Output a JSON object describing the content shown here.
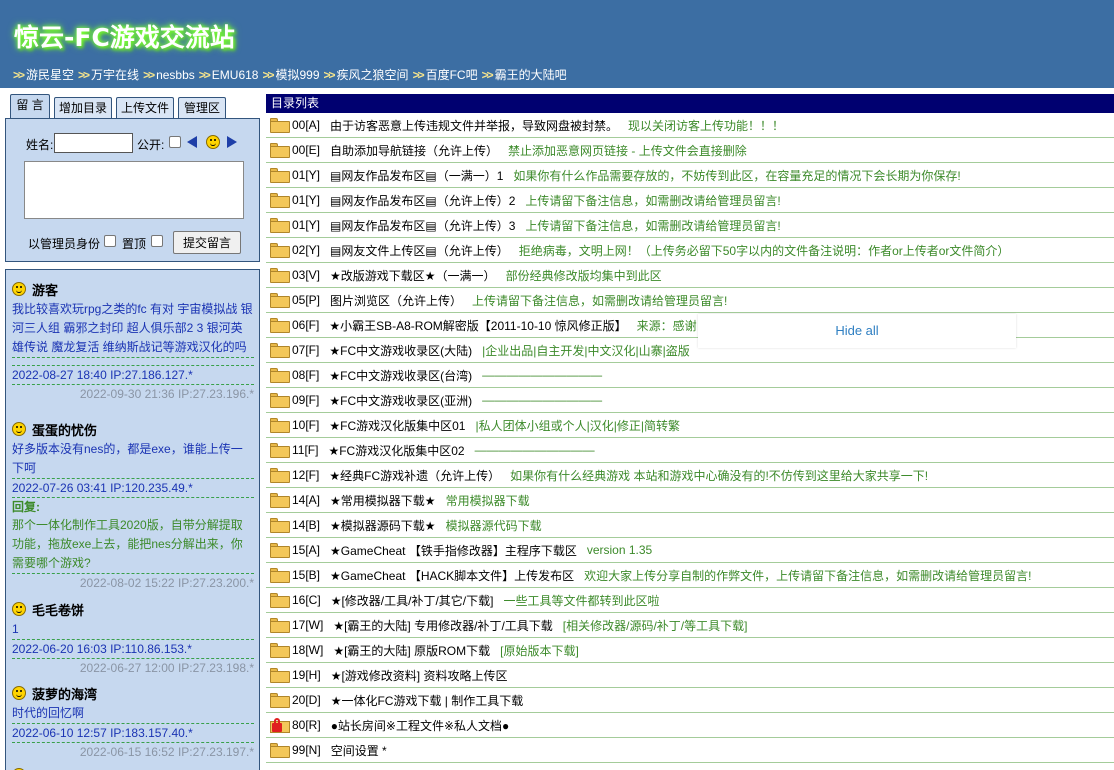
{
  "header": {
    "title": "惊云-FC游戏交流站",
    "nav_arrows": ">>",
    "nav_links": [
      "游民星空",
      "万宇在线",
      "nesbbs",
      "EMU618",
      "模拟999",
      "疾风之狼空间",
      "百度FC吧",
      "霸王的大陆吧"
    ]
  },
  "tabs": [
    "留 言",
    "增加目录",
    "上传文件",
    "管理区"
  ],
  "form": {
    "name_label": "姓名:",
    "public_label": "公开:",
    "admin_label": "以管理员身份",
    "pin_label": "置顶",
    "submit_label": "提交留言",
    "prev_icon": "left-triangle-icon",
    "next_icon": "right-triangle-icon"
  },
  "messages": [
    {
      "author": "游客",
      "body": "我比较喜欢玩rpg之类的fc 有对 宇宙模拟战 银河三人组 霸邪之封印 超人俱乐部2 3 银河英雄传说 魔龙复活 维纳斯战记等游戏汉化的吗",
      "meta": "2022-08-27 18:40 IP:27.186.127.*",
      "reply_label": "",
      "reply": "",
      "reply_time": "2022-09-30 21:36 IP:27.23.196.*"
    },
    {
      "author": "蛋蛋的忧伤",
      "body": "好多版本没有nes的，都是exe，谁能上传一下呵",
      "meta": "2022-07-26 03:41 IP:120.235.49.*",
      "reply_label": "回复:",
      "reply": "那个一体化制作工具2020版，自带分解提取功能，拖放exe上去，能把nes分解出来，你需要哪个游戏?",
      "reply_time": "2022-08-02 15:22 IP:27.23.200.*"
    },
    {
      "author": "毛毛卷饼",
      "body": "1",
      "meta": "2022-06-20 16:03 IP:110.86.153.*",
      "reply_label": "",
      "reply": "",
      "reply_time": "2022-06-27 12:00 IP:27.23.198.*"
    },
    {
      "author": "菠萝的海湾",
      "body": "时代的回忆啊",
      "meta": "2022-06-10 12:57 IP:183.157.40.*",
      "reply_label": "",
      "reply": "",
      "reply_time": "2022-06-15 16:52 IP:27.23.197.*"
    }
  ],
  "directory": {
    "header": "目录列表",
    "rows": [
      {
        "code": "00[A]",
        "name": "由于访客恶意上传违规文件并举报，导致网盘被封禁。",
        "desc": "现以关闭访客上传功能！！！",
        "icon": "folder-icon"
      },
      {
        "code": "00[E]",
        "name": "自助添加导航链接（允许上传）",
        "desc": "禁止添加恶意网页链接 - 上传文件会直接删除",
        "icon": "folder-icon"
      },
      {
        "code": "01[Y]",
        "name": "▤网友作品发布区▤（一满一）1",
        "desc": "如果你有什么作品需要存放的，不妨传到此区，在容量充足的情况下会长期为你保存!",
        "icon": "folder-icon"
      },
      {
        "code": "01[Y]",
        "name": "▤网友作品发布区▤（允许上传）2",
        "desc": "上传请留下备注信息，如需删改请给管理员留言!",
        "icon": "folder-icon"
      },
      {
        "code": "01[Y]",
        "name": "▤网友作品发布区▤（允许上传）3",
        "desc": "上传请留下备注信息，如需删改请给管理员留言!",
        "icon": "folder-icon"
      },
      {
        "code": "02[Y]",
        "name": "▤网友文件上传区▤（允许上传）",
        "desc": "拒绝病毒，文明上网！（上传务必留下50字以内的文件备注说明：作者or上传者or文件简介）",
        "icon": "folder-icon"
      },
      {
        "code": "03[V]",
        "name": "★改版游戏下载区★（一满一）",
        "desc": "部份经典修改版均集中到此区",
        "icon": "folder-icon"
      },
      {
        "code": "05[P]",
        "name": "图片浏览区（允许上传）",
        "desc": "上传请留下备注信息，如需删改请给管理员留言!",
        "icon": "folder-icon"
      },
      {
        "code": "06[F]",
        "name": "★小霸王SB-A8-ROM解密版【2011-10-10 惊风修正版】",
        "desc": "来源：感谢",
        "icon": "folder-icon"
      },
      {
        "code": "07[F]",
        "name": "★FC中文游戏收录区(大陆)",
        "desc": "|企业出品|自主开发|中文汉化|山寨|盗版",
        "icon": "folder-icon"
      },
      {
        "code": "08[F]",
        "name": "★FC中文游戏收录区(台湾)",
        "desc": "——————————",
        "icon": "folder-icon"
      },
      {
        "code": "09[F]",
        "name": "★FC中文游戏收录区(亚洲)",
        "desc": "——————————",
        "icon": "folder-icon"
      },
      {
        "code": "10[F]",
        "name": "★FC游戏汉化版集中区01",
        "desc": "|私人团体小组或个人|汉化|修正|简转繁",
        "icon": "folder-icon"
      },
      {
        "code": "11[F]",
        "name": "★FC游戏汉化版集中区02",
        "desc": "——————————",
        "icon": "folder-icon"
      },
      {
        "code": "12[F]",
        "name": "★经典FC游戏补遗（允许上传）",
        "desc": "如果你有什么经典游戏 本站和游戏中心确没有的!不仿传到这里给大家共享一下!",
        "icon": "folder-icon"
      },
      {
        "code": "14[A]",
        "name": "★常用模拟器下载★",
        "desc": "常用模拟器下载",
        "icon": "folder-icon"
      },
      {
        "code": "14[B]",
        "name": "★模拟器源码下载★",
        "desc": "模拟器源代码下载",
        "icon": "folder-icon"
      },
      {
        "code": "15[A]",
        "name": "★GameCheat 【铁手指修改器】主程序下载区",
        "desc": "version 1.35",
        "icon": "folder-icon"
      },
      {
        "code": "15[B]",
        "name": "★GameCheat 【HACK脚本文件】上传发布区",
        "desc": "欢迎大家上传分享自制的作弊文件，上传请留下备注信息，如需删改请给管理员留言!",
        "icon": "folder-icon"
      },
      {
        "code": "16[C]",
        "name": "★[修改器/工具/补丁/其它/下载]",
        "desc": "一些工具等文件都转到此区啦",
        "icon": "folder-icon"
      },
      {
        "code": "17[W]",
        "name": "★[霸王的大陆] 专用修改器/补丁/工具下载",
        "desc": "[相关修改器/源码/补丁/等工具下载]",
        "icon": "folder-icon"
      },
      {
        "code": "18[W]",
        "name": "★[霸王的大陆] 原版ROM下载",
        "desc": "[原始版本下载]",
        "icon": "folder-icon"
      },
      {
        "code": "19[H]",
        "name": "★[游戏修改资料] 资料攻略上传区",
        "desc": "",
        "icon": "folder-icon"
      },
      {
        "code": "20[D]",
        "name": "★一体化FC游戏下载 | 制作工具下载",
        "desc": "",
        "icon": "folder-icon"
      },
      {
        "code": "80[R]",
        "name": "●站长房间※工程文件※私人文档●",
        "desc": "",
        "icon": "lock-icon"
      },
      {
        "code": "99[N]",
        "name": "空间设置 *",
        "desc": "",
        "icon": "folder-icon"
      }
    ]
  },
  "popup": {
    "hide_all": "Hide all"
  },
  "colors": {
    "header_bg": "#3c6ea3",
    "dir_header_bg": "#000070",
    "panel_bg": "#c6d8ef",
    "desc_green": "#3c8a2a",
    "msg_blue": "#1a33b3"
  }
}
